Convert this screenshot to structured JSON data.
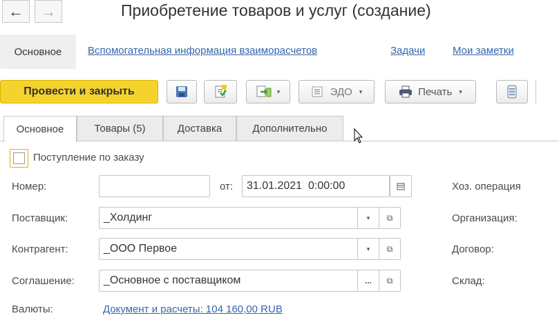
{
  "window": {
    "title": "Приобретение товаров и услуг (создание)"
  },
  "sections": {
    "active": "Основное",
    "links": [
      "Вспомогательная информация взаиморасчетов",
      "Задачи",
      "Мои заметки"
    ]
  },
  "toolbar": {
    "post_close_label": "Провести и закрыть",
    "edo_label": "ЭДО",
    "print_label": "Печать"
  },
  "tabs": [
    "Основное",
    "Товары (5)",
    "Доставка",
    "Дополнительно"
  ],
  "form": {
    "order_checkbox_label": "Поступление по заказу",
    "number_label": "Номер:",
    "number_value": "",
    "from_label": "от:",
    "date_value": "31.01.2021  0:00:00",
    "supplier_label": "Поставщик:",
    "supplier_value": "_Холдинг",
    "contractor_label": "Контрагент:",
    "contractor_value": "_ООО Первое",
    "agreement_label": "Соглашение:",
    "agreement_value": "_Основное с поставщиком",
    "currency_label": "Валюты:",
    "currency_link": "Документ и расчеты: 104 160,00 RUB",
    "right_labels": [
      "Хоз. операция",
      "Организация:",
      "Договор:",
      "Склад:"
    ]
  }
}
